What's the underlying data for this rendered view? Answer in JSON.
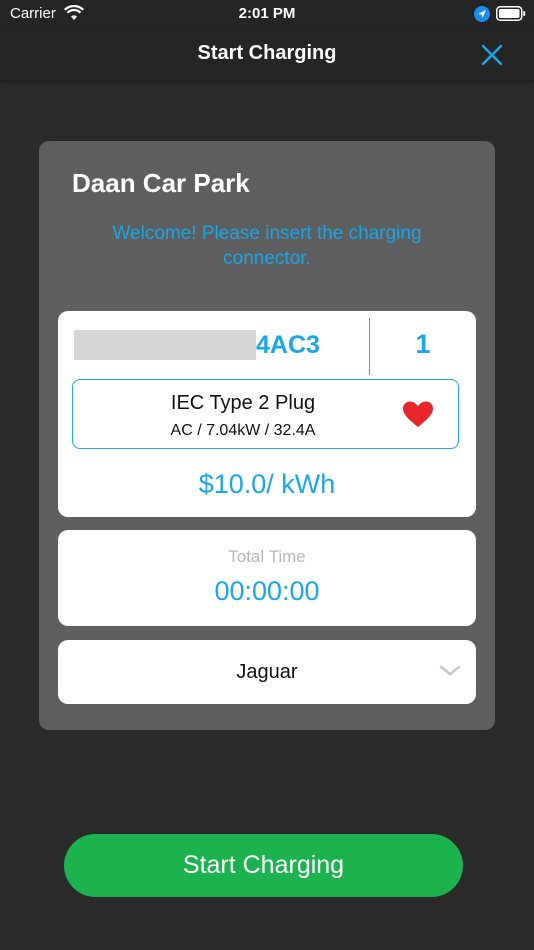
{
  "status_bar": {
    "carrier": "Carrier",
    "time": "2:01 PM",
    "icons": [
      "wifi-icon",
      "location-icon",
      "battery-icon"
    ]
  },
  "nav": {
    "title": "Start Charging",
    "close_icon": "close-icon"
  },
  "station": {
    "name": "Daan Car Park",
    "message": "Welcome! Please insert the charging connector.",
    "charger_id_suffix": "4AC3",
    "connector_number": "1",
    "connector": {
      "type": "IEC Type 2 Plug",
      "spec": "AC / 7.04kW / 32.4A",
      "favorite_icon": "heart-icon"
    },
    "price": "$10.0/ kWh"
  },
  "timer": {
    "label": "Total Time",
    "value": "00:00:00"
  },
  "vehicle": {
    "selected": "Jaguar"
  },
  "actions": {
    "start_label": "Start Charging"
  },
  "colors": {
    "accent": "#1aa6e8",
    "start_button": "#1cb34e",
    "favorite": "#e8262b",
    "background": "#2b2b2b",
    "card": "#5f5f5f"
  }
}
